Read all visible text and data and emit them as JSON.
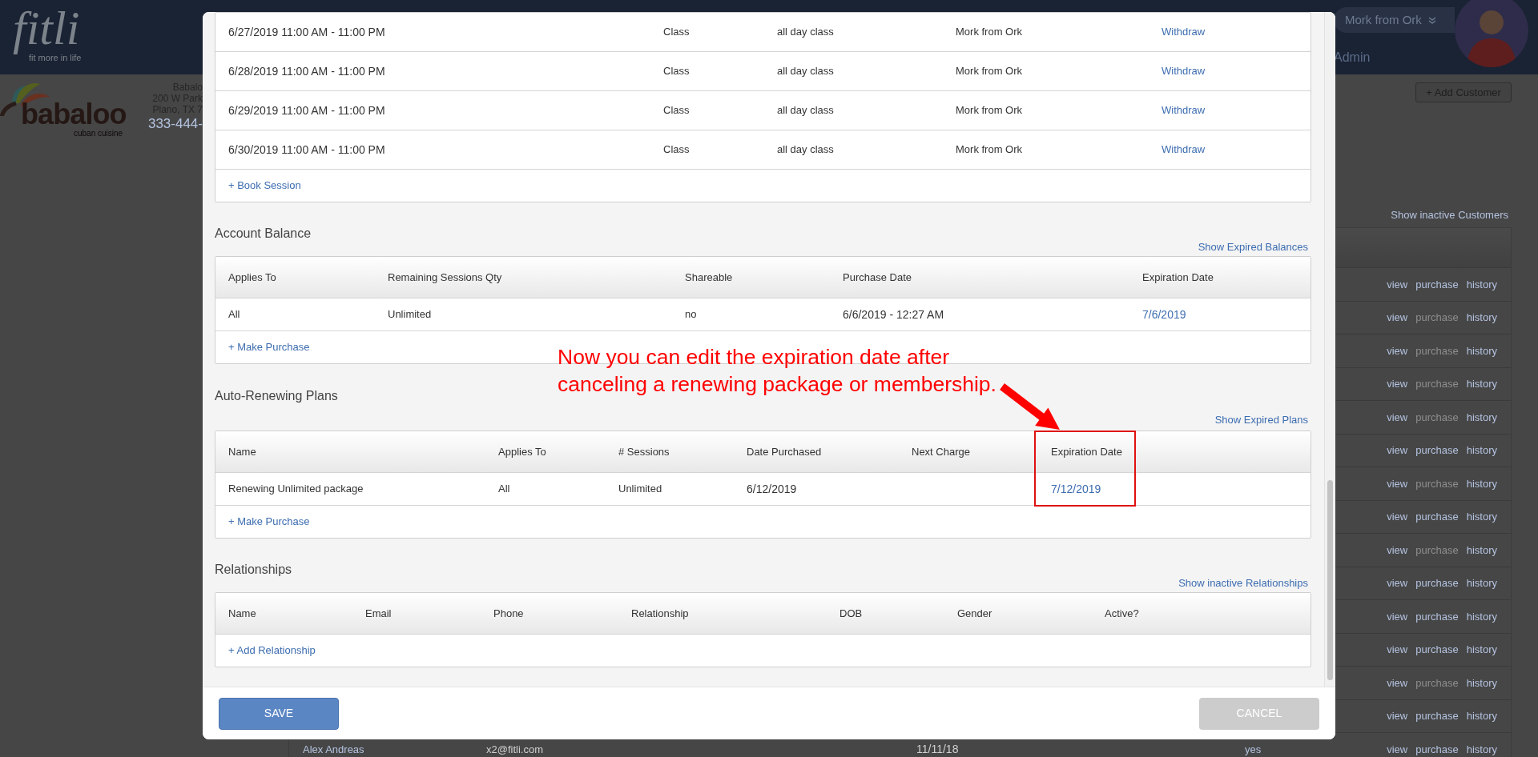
{
  "header": {
    "logo": "fitli",
    "tagline": "fit more in life",
    "user": {
      "name": "Mork from Ork",
      "role": "Admin"
    }
  },
  "business": {
    "logo_name": "babaloo",
    "logo_subtitle": "cuban cuisine",
    "name": "Babalo",
    "address_line_1": "200 W Park",
    "address_line_2": "Plano, TX 7",
    "phone": "333-444-"
  },
  "customers": {
    "add_button": "+ Add Customer",
    "show_inactive_link": "Show inactive Customers",
    "rows": [
      {
        "actions": [
          "view",
          "purchase",
          "history"
        ],
        "purchase_disabled": false
      },
      {
        "actions": [
          "view",
          "purchase",
          "history"
        ],
        "purchase_disabled": true
      },
      {
        "actions": [
          "view",
          "purchase",
          "history"
        ],
        "purchase_disabled": true
      },
      {
        "actions": [
          "view",
          "purchase",
          "history"
        ],
        "purchase_disabled": true
      },
      {
        "actions": [
          "view",
          "purchase",
          "history"
        ],
        "purchase_disabled": true
      },
      {
        "actions": [
          "view",
          "purchase",
          "history"
        ],
        "purchase_disabled": false
      },
      {
        "actions": [
          "view",
          "purchase",
          "history"
        ],
        "purchase_disabled": true
      },
      {
        "actions": [
          "view",
          "purchase",
          "history"
        ],
        "purchase_disabled": false
      },
      {
        "actions": [
          "view",
          "purchase",
          "history"
        ],
        "purchase_disabled": true
      },
      {
        "actions": [
          "view",
          "purchase",
          "history"
        ],
        "purchase_disabled": false
      },
      {
        "actions": [
          "view",
          "purchase",
          "history"
        ],
        "purchase_disabled": false
      },
      {
        "actions": [
          "view",
          "purchase",
          "history"
        ],
        "purchase_disabled": false
      },
      {
        "actions": [
          "view",
          "purchase",
          "history"
        ],
        "purchase_disabled": true
      },
      {
        "actions": [
          "view",
          "purchase",
          "history"
        ],
        "purchase_disabled": false
      },
      {
        "name": "Alex Andreas",
        "email": "x2@fitli.com",
        "date": "11/11/18",
        "active": "yes",
        "actions": [
          "view",
          "purchase",
          "history"
        ],
        "purchase_disabled": false
      }
    ]
  },
  "modal": {
    "sessions": {
      "rows": [
        {
          "date_time": "6/27/2019 11:00 AM - 11:00 PM",
          "type": "Class",
          "description": "all day class",
          "instructor": "Mork from Ork",
          "action": "Withdraw"
        },
        {
          "date_time": "6/28/2019 11:00 AM - 11:00 PM",
          "type": "Class",
          "description": "all day class",
          "instructor": "Mork from Ork",
          "action": "Withdraw"
        },
        {
          "date_time": "6/29/2019 11:00 AM - 11:00 PM",
          "type": "Class",
          "description": "all day class",
          "instructor": "Mork from Ork",
          "action": "Withdraw"
        },
        {
          "date_time": "6/30/2019 11:00 AM - 11:00 PM",
          "type": "Class",
          "description": "all day class",
          "instructor": "Mork from Ork",
          "action": "Withdraw"
        }
      ],
      "add_link": "+ Book Session"
    },
    "account_balance": {
      "title": "Account Balance",
      "show_link": "Show Expired Balances",
      "columns": [
        "Applies To",
        "Remaining Sessions Qty",
        "Shareable",
        "Purchase Date",
        "Expiration Date"
      ],
      "rows": [
        {
          "cells": [
            "All",
            "Unlimited",
            "no",
            "6/6/2019 - 12:27 AM"
          ],
          "expiration_date": "7/6/2019"
        }
      ],
      "add_link": "+ Make Purchase"
    },
    "auto_renewing_plans": {
      "title": "Auto-Renewing Plans",
      "show_link": "Show Expired Plans",
      "columns": [
        "Name",
        "Applies To",
        "# Sessions",
        "Date Purchased",
        "Next Charge",
        "Expiration Date"
      ],
      "rows": [
        {
          "cells": [
            "Renewing Unlimited package",
            "All",
            "Unlimited",
            "6/12/2019"
          ],
          "expiration_date": "7/12/2019"
        }
      ],
      "add_link": "+ Make Purchase"
    },
    "relationships": {
      "title": "Relationships",
      "show_link": "Show inactive Relationships",
      "columns": [
        "Name",
        "Email",
        "Phone",
        "Relationship",
        "DOB",
        "Gender",
        "Active?"
      ],
      "add_link": "+ Add Relationship"
    },
    "annotation": "Now you can edit the expiration date after canceling a renewing package or membership.",
    "buttons": {
      "save": "SAVE",
      "cancel": "CANCEL"
    }
  }
}
